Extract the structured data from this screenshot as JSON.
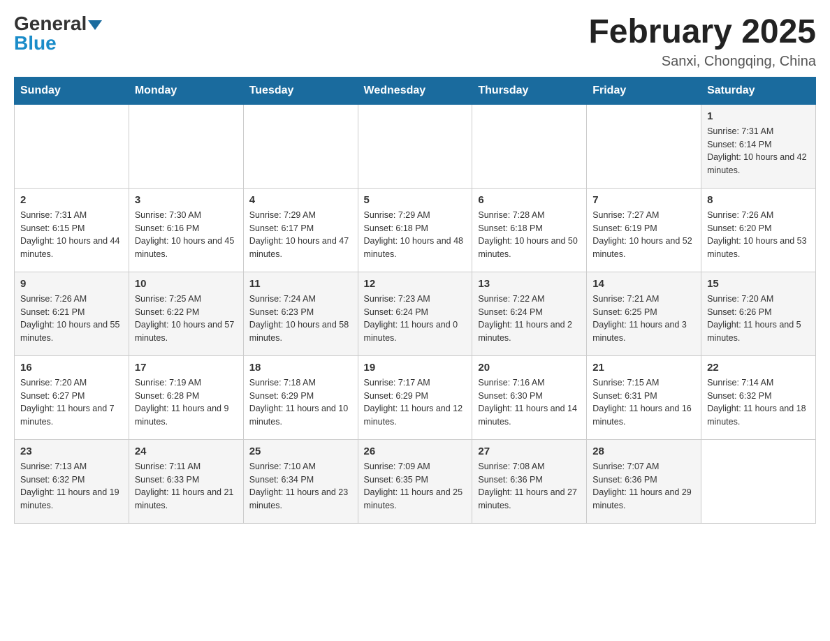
{
  "logo": {
    "general": "General",
    "blue": "Blue"
  },
  "calendar": {
    "title": "February 2025",
    "subtitle": "Sanxi, Chongqing, China"
  },
  "headers": [
    "Sunday",
    "Monday",
    "Tuesday",
    "Wednesday",
    "Thursday",
    "Friday",
    "Saturday"
  ],
  "weeks": [
    [
      {
        "day": "",
        "info": ""
      },
      {
        "day": "",
        "info": ""
      },
      {
        "day": "",
        "info": ""
      },
      {
        "day": "",
        "info": ""
      },
      {
        "day": "",
        "info": ""
      },
      {
        "day": "",
        "info": ""
      },
      {
        "day": "1",
        "info": "Sunrise: 7:31 AM\nSunset: 6:14 PM\nDaylight: 10 hours and 42 minutes."
      }
    ],
    [
      {
        "day": "2",
        "info": "Sunrise: 7:31 AM\nSunset: 6:15 PM\nDaylight: 10 hours and 44 minutes."
      },
      {
        "day": "3",
        "info": "Sunrise: 7:30 AM\nSunset: 6:16 PM\nDaylight: 10 hours and 45 minutes."
      },
      {
        "day": "4",
        "info": "Sunrise: 7:29 AM\nSunset: 6:17 PM\nDaylight: 10 hours and 47 minutes."
      },
      {
        "day": "5",
        "info": "Sunrise: 7:29 AM\nSunset: 6:18 PM\nDaylight: 10 hours and 48 minutes."
      },
      {
        "day": "6",
        "info": "Sunrise: 7:28 AM\nSunset: 6:18 PM\nDaylight: 10 hours and 50 minutes."
      },
      {
        "day": "7",
        "info": "Sunrise: 7:27 AM\nSunset: 6:19 PM\nDaylight: 10 hours and 52 minutes."
      },
      {
        "day": "8",
        "info": "Sunrise: 7:26 AM\nSunset: 6:20 PM\nDaylight: 10 hours and 53 minutes."
      }
    ],
    [
      {
        "day": "9",
        "info": "Sunrise: 7:26 AM\nSunset: 6:21 PM\nDaylight: 10 hours and 55 minutes."
      },
      {
        "day": "10",
        "info": "Sunrise: 7:25 AM\nSunset: 6:22 PM\nDaylight: 10 hours and 57 minutes."
      },
      {
        "day": "11",
        "info": "Sunrise: 7:24 AM\nSunset: 6:23 PM\nDaylight: 10 hours and 58 minutes."
      },
      {
        "day": "12",
        "info": "Sunrise: 7:23 AM\nSunset: 6:24 PM\nDaylight: 11 hours and 0 minutes."
      },
      {
        "day": "13",
        "info": "Sunrise: 7:22 AM\nSunset: 6:24 PM\nDaylight: 11 hours and 2 minutes."
      },
      {
        "day": "14",
        "info": "Sunrise: 7:21 AM\nSunset: 6:25 PM\nDaylight: 11 hours and 3 minutes."
      },
      {
        "day": "15",
        "info": "Sunrise: 7:20 AM\nSunset: 6:26 PM\nDaylight: 11 hours and 5 minutes."
      }
    ],
    [
      {
        "day": "16",
        "info": "Sunrise: 7:20 AM\nSunset: 6:27 PM\nDaylight: 11 hours and 7 minutes."
      },
      {
        "day": "17",
        "info": "Sunrise: 7:19 AM\nSunset: 6:28 PM\nDaylight: 11 hours and 9 minutes."
      },
      {
        "day": "18",
        "info": "Sunrise: 7:18 AM\nSunset: 6:29 PM\nDaylight: 11 hours and 10 minutes."
      },
      {
        "day": "19",
        "info": "Sunrise: 7:17 AM\nSunset: 6:29 PM\nDaylight: 11 hours and 12 minutes."
      },
      {
        "day": "20",
        "info": "Sunrise: 7:16 AM\nSunset: 6:30 PM\nDaylight: 11 hours and 14 minutes."
      },
      {
        "day": "21",
        "info": "Sunrise: 7:15 AM\nSunset: 6:31 PM\nDaylight: 11 hours and 16 minutes."
      },
      {
        "day": "22",
        "info": "Sunrise: 7:14 AM\nSunset: 6:32 PM\nDaylight: 11 hours and 18 minutes."
      }
    ],
    [
      {
        "day": "23",
        "info": "Sunrise: 7:13 AM\nSunset: 6:32 PM\nDaylight: 11 hours and 19 minutes."
      },
      {
        "day": "24",
        "info": "Sunrise: 7:11 AM\nSunset: 6:33 PM\nDaylight: 11 hours and 21 minutes."
      },
      {
        "day": "25",
        "info": "Sunrise: 7:10 AM\nSunset: 6:34 PM\nDaylight: 11 hours and 23 minutes."
      },
      {
        "day": "26",
        "info": "Sunrise: 7:09 AM\nSunset: 6:35 PM\nDaylight: 11 hours and 25 minutes."
      },
      {
        "day": "27",
        "info": "Sunrise: 7:08 AM\nSunset: 6:36 PM\nDaylight: 11 hours and 27 minutes."
      },
      {
        "day": "28",
        "info": "Sunrise: 7:07 AM\nSunset: 6:36 PM\nDaylight: 11 hours and 29 minutes."
      },
      {
        "day": "",
        "info": ""
      }
    ]
  ]
}
